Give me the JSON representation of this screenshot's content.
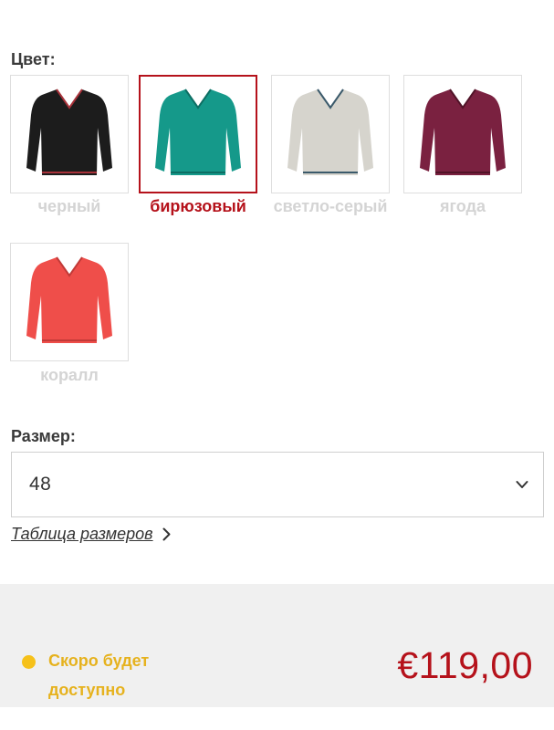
{
  "color_section": {
    "label": "Цвет:",
    "selected": "бирюзовый",
    "options": [
      {
        "name": "черный",
        "color": "#1c1c1c",
        "trim": "#a8323a",
        "selected": false
      },
      {
        "name": "бирюзовый",
        "color": "#15998a",
        "trim": "#0d6e63",
        "selected": true
      },
      {
        "name": "светло-серый",
        "color": "#d6d4cd",
        "trim": "#3b5a6b",
        "selected": false
      },
      {
        "name": "ягода",
        "color": "#7a2140",
        "trim": "#511428",
        "selected": false
      },
      {
        "name": "коралл",
        "color": "#ef4e4a",
        "trim": "#c23a38",
        "selected": false
      }
    ]
  },
  "size_section": {
    "label": "Размер:",
    "selected_value": "48",
    "size_table_link": "Таблица размеров"
  },
  "footer": {
    "availability_text": "Скоро будет доступно",
    "availability_color": "#f6c11a",
    "price": "€119,00",
    "price_color": "#b5121b"
  },
  "icons": {
    "dropdown": "chevron-down-icon",
    "link_arrow": "chevron-right-icon",
    "availability": "status-dot-icon"
  }
}
